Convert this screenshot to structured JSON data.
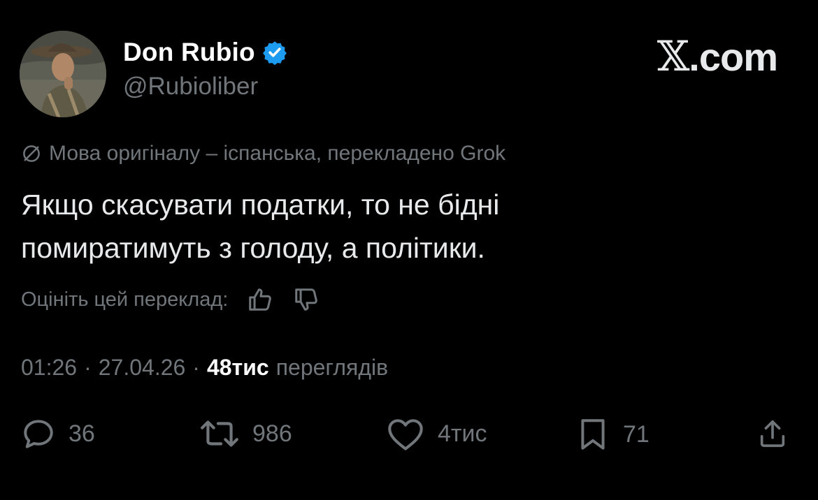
{
  "author": {
    "display_name": "Don Rubio",
    "handle": "@Rubioliber"
  },
  "brand": {
    "prefix": "𝕏",
    "suffix": ".com"
  },
  "translation_note": "Мова оригіналу – іспанська, перекладено Grok",
  "tweet_text_line1": "Якщо скасувати податки, то не бідні",
  "tweet_text_line2": "помиратимуть з голоду, а політики.",
  "rate": {
    "label": "Оцініть цей переклад:"
  },
  "meta": {
    "time": "01:26",
    "separator": "·",
    "date": "27.04.26",
    "views_count": "48тис",
    "views_label": "переглядів"
  },
  "actions": {
    "replies": "36",
    "reposts": "986",
    "likes": "4тис",
    "bookmarks": "71"
  },
  "colors": {
    "background": "#000000",
    "text": "#e7e9ea",
    "muted": "#71767b",
    "verified": "#1d9bf0"
  }
}
